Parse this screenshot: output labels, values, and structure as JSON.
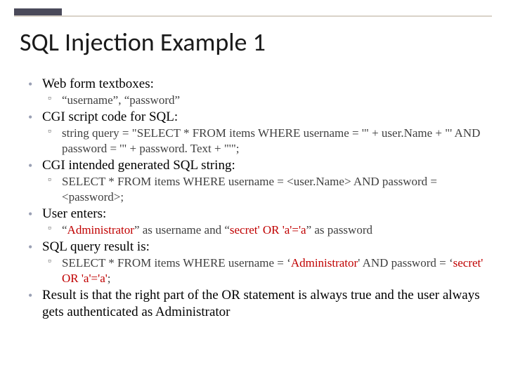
{
  "title": "SQL Injection Example 1",
  "b1": {
    "text": "Web form textboxes:"
  },
  "b1s1": {
    "text": "“username”, “password”"
  },
  "b2": {
    "text": "CGI script code for SQL:"
  },
  "b2s1": {
    "text": "string query = \"SELECT * FROM items WHERE username = '\" + user.Name + \"' AND password = '\" + password. Text + \"'\";"
  },
  "b3": {
    "text": "CGI intended generated SQL string:"
  },
  "b3s1": {
    "text": "SELECT * FROM items WHERE username = <user.Name> AND password = <password>;"
  },
  "b4": {
    "text": "User enters:"
  },
  "b4s1": {
    "pre1": "“",
    "red1": "Administrator",
    "mid1": "” as username and “",
    "red2": "secret' OR 'a'='a",
    "post1": "” as password"
  },
  "b5": {
    "text": "SQL query result is:"
  },
  "b5s1": {
    "pre": "SELECT * FROM items WHERE username = ‘",
    "red1": "Administrator",
    "mid": "' AND password = ‘",
    "red2": "secret' OR 'a'='a'",
    "post": ";"
  },
  "b6": {
    "text": "Result is that the right part of the OR statement is always true and the user always gets authenticated as Administrator"
  }
}
